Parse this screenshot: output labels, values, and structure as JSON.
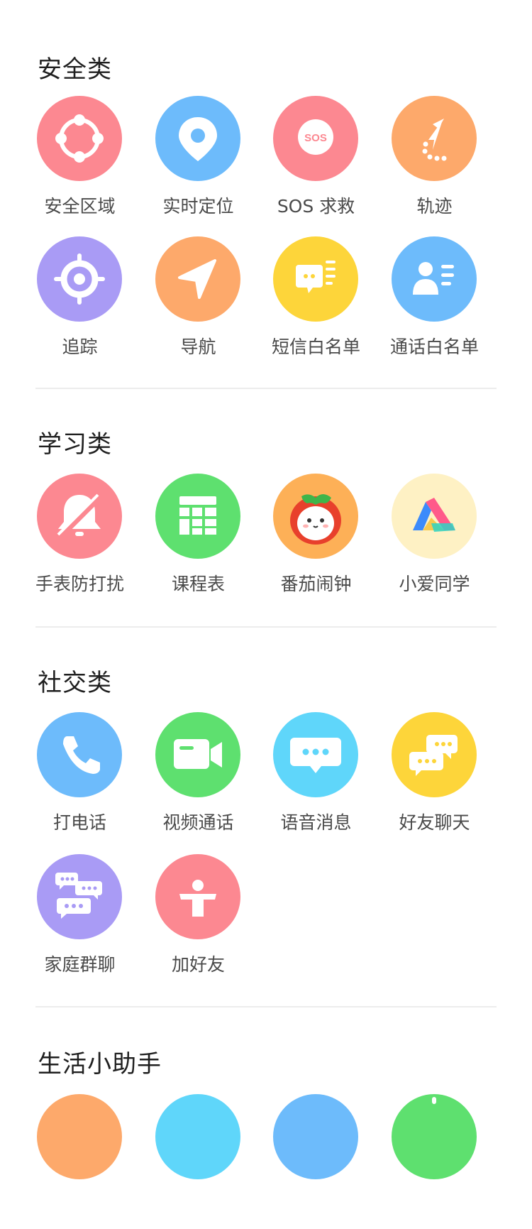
{
  "sections": {
    "safety": {
      "title": "安全类",
      "items": [
        {
          "label": "安全区域",
          "color": "#FC8891",
          "icon": "safe-zone-icon"
        },
        {
          "label": "实时定位",
          "color": "#6DBBFB",
          "icon": "location-pin-icon"
        },
        {
          "label": "SOS 求救",
          "color": "#FC8891",
          "icon": "sos-icon",
          "icon_text": "SOS"
        },
        {
          "label": "轨迹",
          "color": "#FDA96B",
          "icon": "track-icon"
        },
        {
          "label": "追踪",
          "color": "#A99BF5",
          "icon": "target-icon"
        },
        {
          "label": "导航",
          "color": "#FDA96B",
          "icon": "navigation-arrow-icon"
        },
        {
          "label": "短信白名单",
          "color": "#FDD53A",
          "icon": "sms-whitelist-icon"
        },
        {
          "label": "通话白名单",
          "color": "#6DBBFB",
          "icon": "call-whitelist-icon"
        }
      ]
    },
    "study": {
      "title": "学习类",
      "items": [
        {
          "label": "手表防打扰",
          "color": "#FC8891",
          "icon": "bell-off-icon"
        },
        {
          "label": "课程表",
          "color": "#5EE06F",
          "icon": "timetable-icon"
        },
        {
          "label": "番茄闹钟",
          "color": "#FDB057",
          "icon": "tomato-icon"
        },
        {
          "label": "小爱同学",
          "color": "#FEF1C4",
          "icon": "xiaoai-logo-icon"
        }
      ]
    },
    "social": {
      "title": "社交类",
      "items": [
        {
          "label": "打电话",
          "color": "#6DBBFB",
          "icon": "phone-icon"
        },
        {
          "label": "视频通话",
          "color": "#5EE06F",
          "icon": "video-camera-icon"
        },
        {
          "label": "语音消息",
          "color": "#5FD6FA",
          "icon": "voice-message-icon"
        },
        {
          "label": "好友聊天",
          "color": "#FDD53A",
          "icon": "friend-chat-icon"
        },
        {
          "label": "家庭群聊",
          "color": "#A99BF5",
          "icon": "family-group-chat-icon"
        },
        {
          "label": "加好友",
          "color": "#FC8891",
          "icon": "add-friend-icon"
        }
      ]
    },
    "life": {
      "title": "生活小助手",
      "items": [
        {
          "color": "#FDA96B"
        },
        {
          "color": "#5FD6FA"
        },
        {
          "color": "#6DBBFB"
        },
        {
          "color": "#5EE06F"
        }
      ]
    }
  }
}
